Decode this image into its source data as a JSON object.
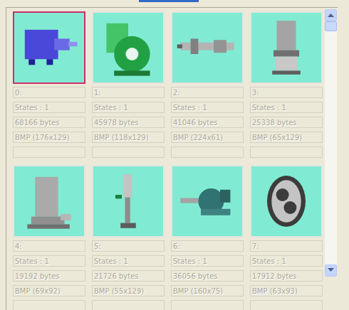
{
  "items": [
    {
      "index": "0:",
      "states": "States : 1",
      "size": "68166 bytes",
      "format": "BMP (176x129)",
      "selected": true
    },
    {
      "index": "1:",
      "states": "States : 1",
      "size": "45978 bytes",
      "format": "BMP (118x129)",
      "selected": false
    },
    {
      "index": "2:",
      "states": "States : 1",
      "size": "41046 bytes",
      "format": "BMP (224x61)",
      "selected": false
    },
    {
      "index": "3:",
      "states": "States : 1",
      "size": "25338 bytes",
      "format": "BMP (65x129)",
      "selected": false
    },
    {
      "index": "4:",
      "states": "States : 1",
      "size": "19192 bytes",
      "format": "BMP (69x92)",
      "selected": false
    },
    {
      "index": "5:",
      "states": "States : 1",
      "size": "21726 bytes",
      "format": "BMP (55x129)",
      "selected": false
    },
    {
      "index": "6:",
      "states": "States : 1",
      "size": "36056 bytes",
      "format": "BMP (160x75)",
      "selected": false
    },
    {
      "index": "7:",
      "states": "States : 1",
      "size": "17912 bytes",
      "format": "BMP (63x93)",
      "selected": false
    }
  ],
  "scrollbar": {
    "level": 0
  }
}
